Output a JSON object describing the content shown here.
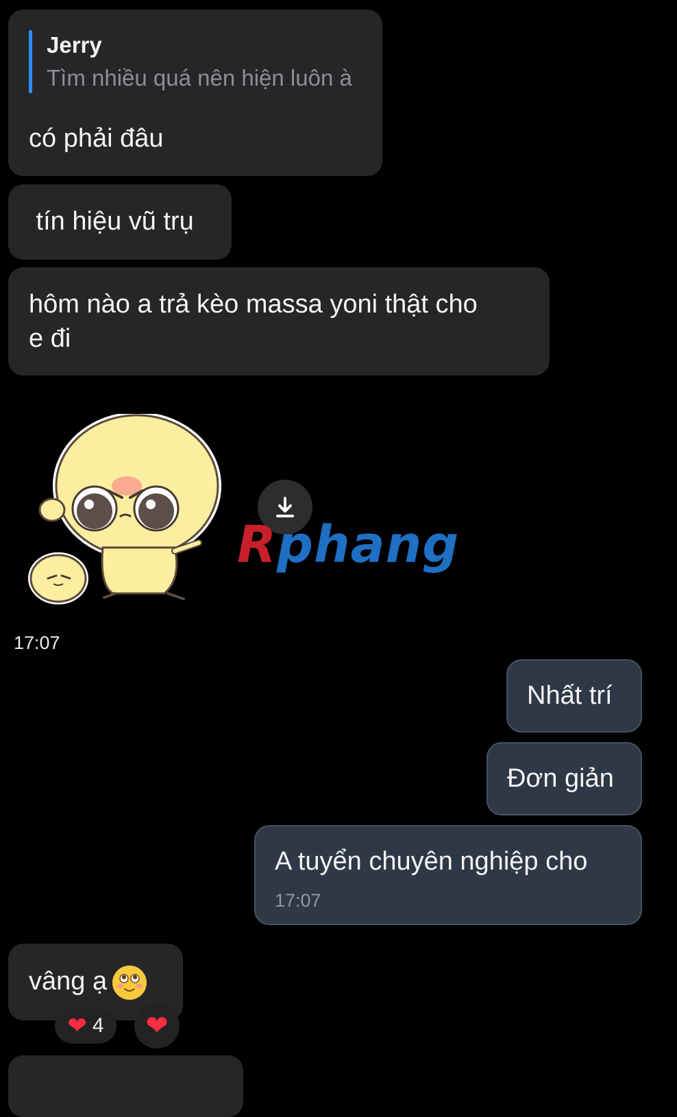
{
  "messages": [
    {
      "id": "m1",
      "reply": {
        "name": "Jerry",
        "text": "Tìm nhiều quá nên hiện luôn à"
      },
      "text": "có phải đâu"
    },
    {
      "id": "m2",
      "text": " tín hiệu vũ trụ"
    },
    {
      "id": "m3",
      "line1": "hôm nào a trả kèo massa yoni thật cho",
      "line2": "e đi"
    },
    {
      "id": "m4",
      "time": "17:07"
    },
    {
      "id": "m5",
      "text": "Nhất trí"
    },
    {
      "id": "m6",
      "text": "Đơn giản"
    },
    {
      "id": "m7",
      "text": "A tuyển chuyên nghiệp cho",
      "time": "17:07"
    },
    {
      "id": "m8",
      "text": "vâng ạ"
    }
  ],
  "reactions": {
    "heart_count": "4"
  },
  "watermark": {
    "first": "R",
    "rest": "phang"
  },
  "icons": {
    "download": "download-icon",
    "heart": "heart-icon",
    "emoji": "smiling-face-emoji-icon",
    "sticker": "angry-chick-sticker"
  },
  "colors": {
    "incoming_bubble": "#262628",
    "outgoing_bubble": "#2f3846",
    "reply_accent": "#2f8cff",
    "heart": "#ff2d43"
  }
}
